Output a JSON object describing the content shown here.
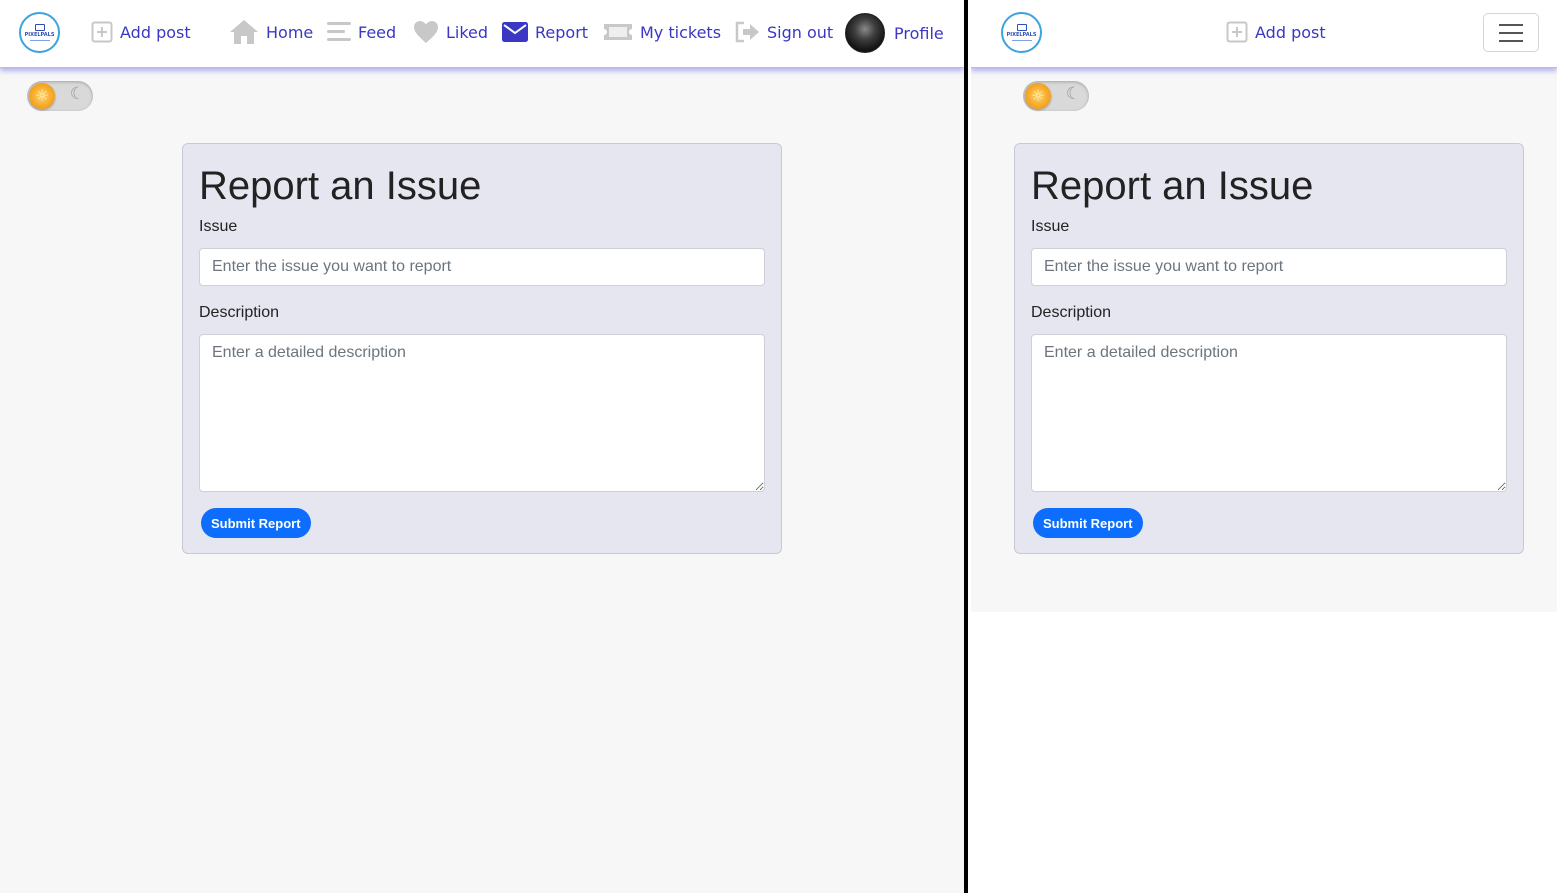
{
  "brand": {
    "logo_text": "PIXELPALS"
  },
  "nav": {
    "add_post": "Add post",
    "home": "Home",
    "feed": "Feed",
    "liked": "Liked",
    "report": "Report",
    "my_tickets": "My tickets",
    "sign_out": "Sign out",
    "profile": "Profile"
  },
  "theme_toggle": {
    "state": "light",
    "sun_glyph": "☼",
    "moon_glyph": "☾"
  },
  "form": {
    "title": "Report an Issue",
    "issue_label": "Issue",
    "issue_placeholder": "Enter the issue you want to report",
    "description_label": "Description",
    "description_placeholder": "Enter a detailed description",
    "submit_label": "Submit Report"
  },
  "colors": {
    "nav_link": "#3b37c4",
    "active_icon": "#3b37c4",
    "inactive_icon": "#c8c8c8",
    "primary_button": "#0d6efd",
    "card_bg": "#e6e6f1",
    "page_bg": "#f7f7f7"
  }
}
